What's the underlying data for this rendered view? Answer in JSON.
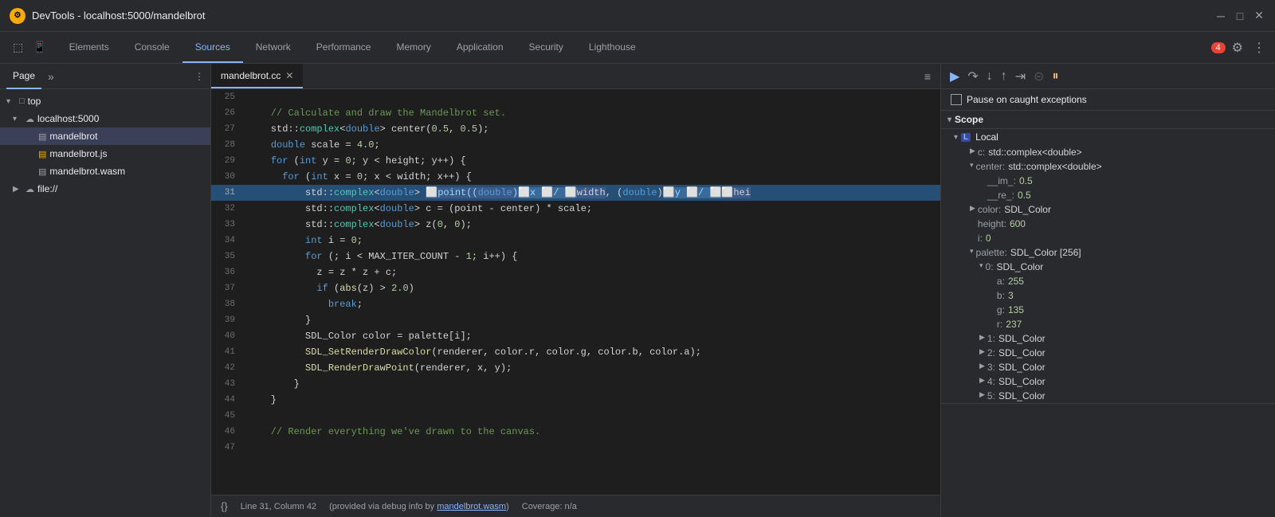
{
  "title_bar": {
    "title": "DevTools - localhost:5000/mandelbrot",
    "icon_label": "D"
  },
  "tabs": {
    "items": [
      {
        "label": "Elements",
        "active": false
      },
      {
        "label": "Console",
        "active": false
      },
      {
        "label": "Sources",
        "active": true
      },
      {
        "label": "Network",
        "active": false
      },
      {
        "label": "Performance",
        "active": false
      },
      {
        "label": "Memory",
        "active": false
      },
      {
        "label": "Application",
        "active": false
      },
      {
        "label": "Security",
        "active": false
      },
      {
        "label": "Lighthouse",
        "active": false
      }
    ],
    "error_count": "4"
  },
  "sidebar": {
    "tab_page": "Page",
    "file_tree": [
      {
        "indent": 0,
        "arrow": "▾",
        "icon": "folder",
        "label": "top",
        "type": "folder"
      },
      {
        "indent": 1,
        "arrow": "▾",
        "icon": "cloud",
        "label": "localhost:5000",
        "type": "cloud"
      },
      {
        "indent": 2,
        "arrow": "",
        "icon": "file-gray",
        "label": "mandelbrot",
        "type": "file-gray",
        "selected": true
      },
      {
        "indent": 2,
        "arrow": "",
        "icon": "file-yellow",
        "label": "mandelbrot.js",
        "type": "file-yellow"
      },
      {
        "indent": 2,
        "arrow": "",
        "icon": "file-gray",
        "label": "mandelbrot.wasm",
        "type": "file-gray"
      },
      {
        "indent": 1,
        "arrow": "▶",
        "icon": "cloud",
        "label": "file://",
        "type": "cloud"
      }
    ]
  },
  "editor": {
    "tab_label": "mandelbrot.cc",
    "lines": [
      {
        "num": "25",
        "content": "",
        "highlight": false
      },
      {
        "num": "26",
        "content": "    // Calculate and draw the Mandelbrot set.",
        "highlight": false,
        "class": "comment"
      },
      {
        "num": "27",
        "content": "    std::complex<double> center(0.5, 0.5);",
        "highlight": false
      },
      {
        "num": "28",
        "content": "    double scale = 4.0;",
        "highlight": false
      },
      {
        "num": "29",
        "content": "    for (int y = 0; y < height; y++) {",
        "highlight": false
      },
      {
        "num": "30",
        "content": "      for (int x = 0; x < width; x++) {",
        "highlight": false
      },
      {
        "num": "31",
        "content": "          std::complex<double>  point((double) x  /  width, (double) y  /  hei",
        "highlight": true
      },
      {
        "num": "32",
        "content": "          std::complex<double> c = (point - center) * scale;",
        "highlight": false
      },
      {
        "num": "33",
        "content": "          std::complex<double> z(0, 0);",
        "highlight": false
      },
      {
        "num": "34",
        "content": "          int i = 0;",
        "highlight": false
      },
      {
        "num": "35",
        "content": "          for (; i < MAX_ITER_COUNT - 1; i++) {",
        "highlight": false
      },
      {
        "num": "36",
        "content": "            z = z * z + c;",
        "highlight": false
      },
      {
        "num": "37",
        "content": "            if (abs(z) > 2.0)",
        "highlight": false
      },
      {
        "num": "38",
        "content": "              break;",
        "highlight": false
      },
      {
        "num": "39",
        "content": "          }",
        "highlight": false
      },
      {
        "num": "40",
        "content": "          SDL_Color color = palette[i];",
        "highlight": false
      },
      {
        "num": "41",
        "content": "          SDL_SetRenderDrawColor(renderer, color.r, color.g, color.b, color.a);",
        "highlight": false
      },
      {
        "num": "42",
        "content": "          SDL_RenderDrawPoint(renderer, x, y);",
        "highlight": false
      },
      {
        "num": "43",
        "content": "        }",
        "highlight": false
      },
      {
        "num": "44",
        "content": "    }",
        "highlight": false
      },
      {
        "num": "45",
        "content": "",
        "highlight": false
      },
      {
        "num": "46",
        "content": "    // Render everything we've drawn to the canvas.",
        "highlight": false,
        "class": "comment"
      },
      {
        "num": "47",
        "content": "",
        "highlight": false
      }
    ]
  },
  "status_bar": {
    "line_col": "Line 31, Column 42",
    "debug_info": "(provided via debug info by",
    "debug_link": "mandelbrot.wasm",
    "coverage": "Coverage: n/a"
  },
  "debug_panel": {
    "pause_exceptions_label": "Pause on caught exceptions",
    "scope_header": "Scope",
    "local_label": "Local",
    "variables": [
      {
        "key": "c:",
        "val": "std::complex<double>",
        "indent": 1,
        "expandable": true,
        "val_class": "obj"
      },
      {
        "key": "center:",
        "val": "std::complex<double>",
        "indent": 1,
        "expandable": true,
        "val_class": "obj"
      },
      {
        "key": "__im_:",
        "val": "0.5",
        "indent": 2,
        "expandable": false,
        "val_class": "num"
      },
      {
        "key": "__re_:",
        "val": "0.5",
        "indent": 2,
        "expandable": false,
        "val_class": "num"
      },
      {
        "key": "color:",
        "val": "SDL_Color",
        "indent": 1,
        "expandable": true,
        "val_class": "obj"
      },
      {
        "key": "height:",
        "val": "600",
        "indent": 1,
        "expandable": false,
        "val_class": "num"
      },
      {
        "key": "i:",
        "val": "0",
        "indent": 1,
        "expandable": false,
        "val_class": "num"
      },
      {
        "key": "palette:",
        "val": "SDL_Color [256]",
        "indent": 1,
        "expandable": true,
        "val_class": "obj"
      },
      {
        "key": "0:",
        "val": "SDL_Color",
        "indent": 2,
        "expandable": true,
        "val_class": "obj"
      },
      {
        "key": "a:",
        "val": "255",
        "indent": 3,
        "expandable": false,
        "val_class": "num"
      },
      {
        "key": "b:",
        "val": "3",
        "indent": 3,
        "expandable": false,
        "val_class": "num"
      },
      {
        "key": "g:",
        "val": "135",
        "indent": 3,
        "expandable": false,
        "val_class": "num"
      },
      {
        "key": "r:",
        "val": "237",
        "indent": 3,
        "expandable": false,
        "val_class": "num"
      },
      {
        "key": "1:",
        "val": "SDL_Color",
        "indent": 2,
        "expandable": true,
        "val_class": "obj"
      },
      {
        "key": "2:",
        "val": "SDL_Color",
        "indent": 2,
        "expandable": true,
        "val_class": "obj"
      },
      {
        "key": "3:",
        "val": "SDL_Color",
        "indent": 2,
        "expandable": true,
        "val_class": "obj"
      },
      {
        "key": "4:",
        "val": "SDL_Color",
        "indent": 2,
        "expandable": true,
        "val_class": "obj"
      },
      {
        "key": "5:",
        "val": "SDL_Color",
        "indent": 2,
        "expandable": true,
        "val_class": "obj"
      }
    ]
  }
}
